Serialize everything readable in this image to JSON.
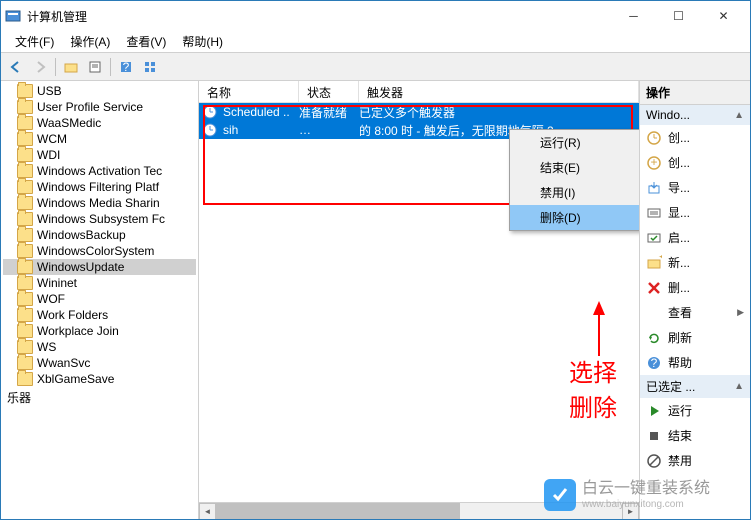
{
  "titlebar": {
    "title": "计算机管理"
  },
  "menubar": {
    "file": "文件(F)",
    "action": "操作(A)",
    "view": "查看(V)",
    "help": "帮助(H)"
  },
  "tree": {
    "items": [
      {
        "label": "USB"
      },
      {
        "label": "User Profile Service"
      },
      {
        "label": "WaaSMedic"
      },
      {
        "label": "WCM"
      },
      {
        "label": "WDI"
      },
      {
        "label": "Windows Activation Tec"
      },
      {
        "label": "Windows Filtering Platf"
      },
      {
        "label": "Windows Media Sharin"
      },
      {
        "label": "Windows Subsystem Fc"
      },
      {
        "label": "WindowsBackup"
      },
      {
        "label": "WindowsColorSystem"
      },
      {
        "label": "WindowsUpdate",
        "selected": true
      },
      {
        "label": "Wininet"
      },
      {
        "label": "WOF"
      },
      {
        "label": "Work Folders"
      },
      {
        "label": "Workplace Join"
      },
      {
        "label": "WS"
      },
      {
        "label": "WwanSvc"
      },
      {
        "label": "XblGameSave"
      }
    ],
    "bottom_label": "乐器"
  },
  "list": {
    "headers": {
      "name": "名称",
      "status": "状态",
      "trigger": "触发器"
    },
    "rows": [
      {
        "name": "Scheduled ..",
        "status": "准备就绪",
        "trigger": "已定义多个触发器"
      },
      {
        "name": "sih",
        "status": "…",
        "trigger": "的 8:00 时 - 触发后，无限期地每隔 2"
      }
    ]
  },
  "context_menu": {
    "run": "运行(R)",
    "end": "结束(E)",
    "disable": "禁用(I)",
    "delete": "删除(D)"
  },
  "annotation": "选择删除",
  "actions": {
    "header": "操作",
    "group1": "Windo...",
    "items1": [
      {
        "icon": "clock",
        "label": "创..."
      },
      {
        "icon": "clock-new",
        "label": "创..."
      },
      {
        "icon": "import",
        "label": "导..."
      },
      {
        "icon": "show",
        "label": "显..."
      },
      {
        "icon": "enable",
        "label": "启..."
      },
      {
        "icon": "folder-new",
        "label": "新..."
      },
      {
        "icon": "delete",
        "label": "删..."
      },
      {
        "icon": "view",
        "label": "查看"
      },
      {
        "icon": "refresh",
        "label": "刷新"
      },
      {
        "icon": "help",
        "label": "帮助"
      }
    ],
    "group2": "已选定 ...",
    "items2": [
      {
        "icon": "run",
        "label": "运行"
      },
      {
        "icon": "end",
        "label": "结束"
      },
      {
        "icon": "disable",
        "label": "禁用"
      }
    ]
  },
  "watermark": {
    "main": "白云一键重装系统",
    "sub": "www.baiyunxitong.com"
  }
}
